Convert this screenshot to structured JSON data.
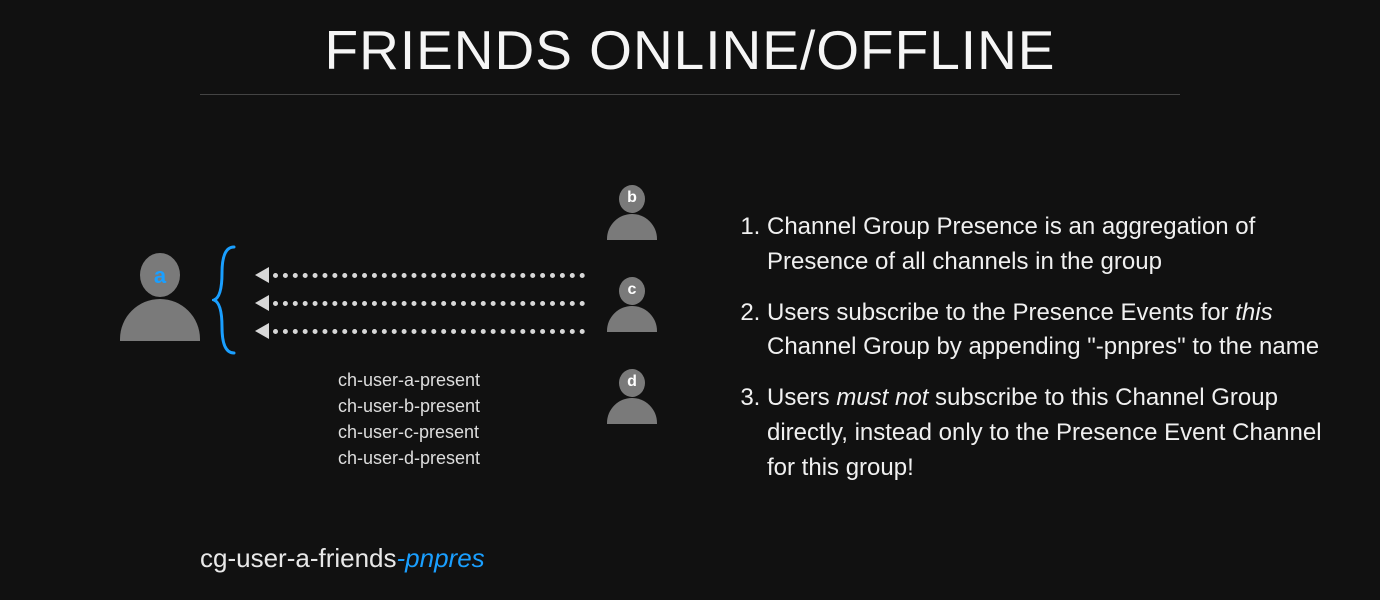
{
  "title": "FRIENDS ONLINE/OFFLINE",
  "userA": {
    "label": "a"
  },
  "friends": [
    {
      "label": "b"
    },
    {
      "label": "c"
    },
    {
      "label": "d"
    }
  ],
  "channels": [
    "ch-user-a-present",
    "ch-user-b-present",
    "ch-user-c-present",
    "ch-user-d-present"
  ],
  "footer": {
    "prefix": "cg-user-a-friends",
    "suffix": "-pnpres"
  },
  "notes": {
    "item1": "Channel Group Presence is an aggregation of Presence of all channels in the group",
    "item2_a": "Users subscribe to the Presence Events for ",
    "item2_em": "this",
    "item2_b": " Channel Group by appending \"-pnpres\" to the name",
    "item3_a": "Users ",
    "item3_em": "must not",
    "item3_b": " subscribe to this Channel Group directly, instead only to the Presence Event Channel for this group!"
  }
}
